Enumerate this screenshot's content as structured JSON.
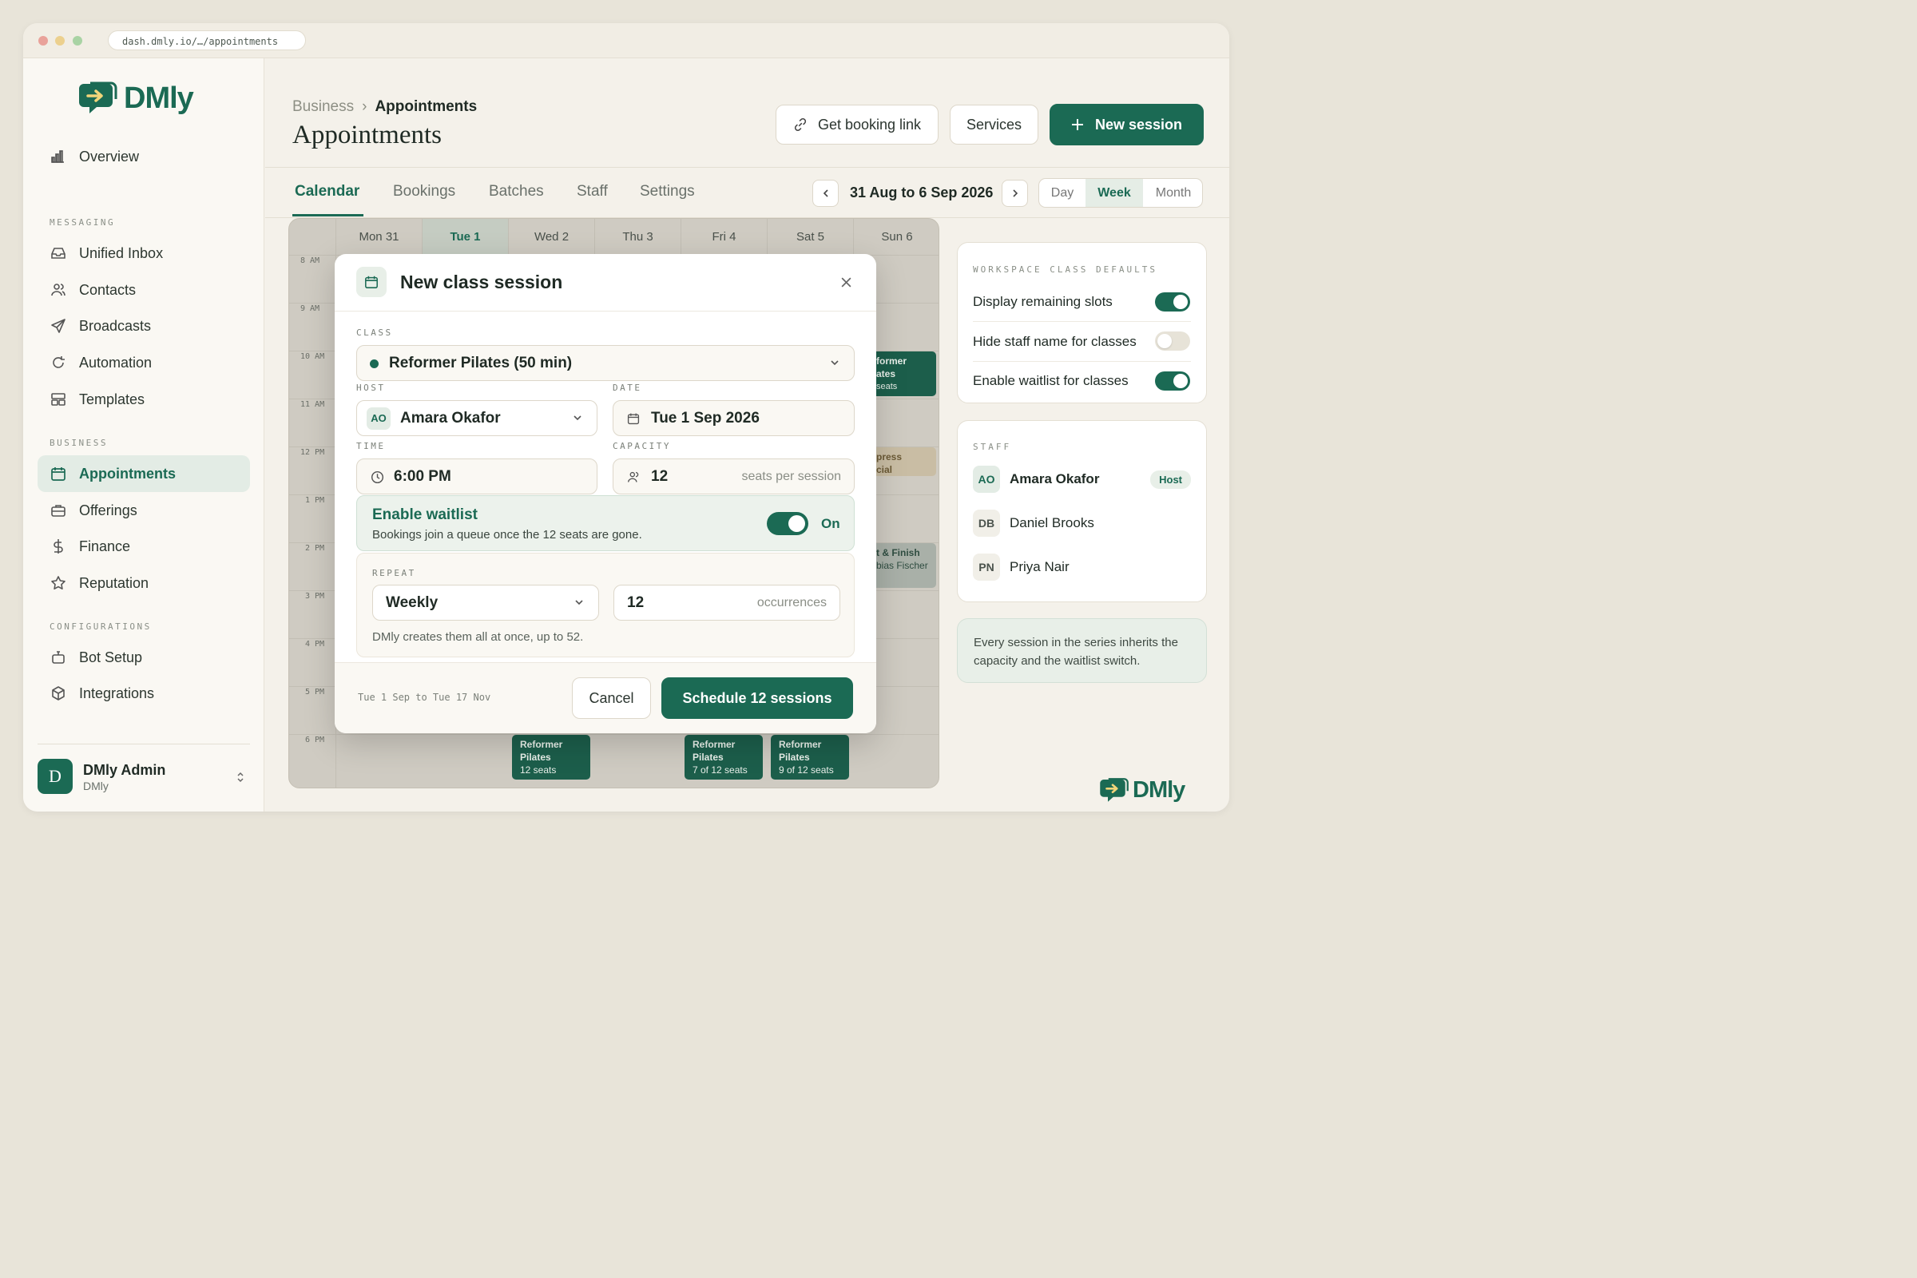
{
  "browser": {
    "url": "dash.dmly.io/…/appointments"
  },
  "brand": {
    "name": "DMly",
    "color": "#1b6a54"
  },
  "sidebar": {
    "top_items": [
      {
        "label": "Overview",
        "icon": "bar-chart-icon"
      }
    ],
    "sections": [
      {
        "title": "MESSAGING",
        "items": [
          {
            "label": "Unified Inbox",
            "icon": "inbox-icon"
          },
          {
            "label": "Contacts",
            "icon": "users-icon"
          },
          {
            "label": "Broadcasts",
            "icon": "send-icon"
          },
          {
            "label": "Automation",
            "icon": "refresh-icon"
          },
          {
            "label": "Templates",
            "icon": "layout-icon"
          }
        ]
      },
      {
        "title": "BUSINESS",
        "items": [
          {
            "label": "Appointments",
            "icon": "calendar-icon",
            "active": true
          },
          {
            "label": "Offerings",
            "icon": "briefcase-icon"
          },
          {
            "label": "Finance",
            "icon": "dollar-icon"
          },
          {
            "label": "Reputation",
            "icon": "star-icon"
          }
        ]
      },
      {
        "title": "CONFIGURATIONS",
        "items": [
          {
            "label": "Bot Setup",
            "icon": "bot-icon"
          },
          {
            "label": "Integrations",
            "icon": "box-icon"
          }
        ]
      }
    ],
    "user": {
      "initial": "D",
      "name": "DMly Admin",
      "org": "DMly"
    }
  },
  "header": {
    "breadcrumb": {
      "parent": "Business",
      "separator": "›",
      "current": "Appointments"
    },
    "title": "Appointments",
    "actions": {
      "booking_link": "Get booking link",
      "services": "Services",
      "new_session": "New session"
    }
  },
  "tabs": [
    "Calendar",
    "Bookings",
    "Batches",
    "Staff",
    "Settings"
  ],
  "active_tab": "Calendar",
  "date_nav": {
    "range": "31 Aug to 6 Sep 2026",
    "views": [
      "Day",
      "Week",
      "Month"
    ],
    "active_view": "Week"
  },
  "calendar": {
    "days": [
      "Mon 31",
      "Tue 1",
      "Wed 2",
      "Thu 3",
      "Fri 4",
      "Sat 5",
      "Sun 6"
    ],
    "today": "Tue 1",
    "hours": [
      "8 AM",
      "9 AM",
      "10 AM",
      "11 AM",
      "12 PM",
      "1 PM",
      "2 PM",
      "3 PM",
      "4 PM",
      "5 PM",
      "6 PM"
    ],
    "events": [
      {
        "line1": "former",
        "line2": "ates",
        "line3": "seats"
      },
      {
        "line1": "press",
        "line2": "cial"
      },
      {
        "line1": "t & Finish",
        "line2": "bias Fischer"
      },
      {
        "line1": "Reformer",
        "line2": "Pilates",
        "line3": "12 seats"
      },
      {
        "line1": "Reformer",
        "line2": "Pilates",
        "line3": "7 of 12 seats"
      },
      {
        "line1": "Reformer",
        "line2": "Pilates",
        "line3": "9 of 12 seats"
      }
    ]
  },
  "defaults_panel": {
    "title": "WORKSPACE CLASS DEFAULTS",
    "items": [
      {
        "label": "Display remaining slots",
        "on": true
      },
      {
        "label": "Hide staff name for classes",
        "on": false
      },
      {
        "label": "Enable waitlist for classes",
        "on": true
      }
    ]
  },
  "staff_panel": {
    "title": "STAFF",
    "members": [
      {
        "initials": "AO",
        "name": "Amara Okafor",
        "badge": "Host"
      },
      {
        "initials": "DB",
        "name": "Daniel Brooks"
      },
      {
        "initials": "PN",
        "name": "Priya Nair"
      }
    ]
  },
  "info_note": "Every session in the series inherits the capacity and the waitlist switch.",
  "modal": {
    "title": "New class session",
    "class_label": "CLASS",
    "class_value": "Reformer Pilates (50 min)",
    "host_label": "HOST",
    "host_initials": "AO",
    "host_value": "Amara Okafor",
    "date_label": "DATE",
    "date_value": "Tue 1 Sep 2026",
    "time_label": "TIME",
    "time_value": "6:00 PM",
    "capacity_label": "CAPACITY",
    "capacity_value": "12",
    "capacity_suffix": "seats per session",
    "waitlist_title": "Enable waitlist",
    "waitlist_desc": "Bookings join a queue once the 12 seats are gone.",
    "waitlist_state": "On",
    "repeat_label": "REPEAT",
    "repeat_value": "Weekly",
    "occurrences_value": "12",
    "occurrences_suffix": "occurrences",
    "repeat_note": "DMly creates them all at once, up to 52.",
    "range_summary": "Tue 1 Sep to Tue 17 Nov",
    "cancel": "Cancel",
    "submit": "Schedule 12 sessions"
  }
}
